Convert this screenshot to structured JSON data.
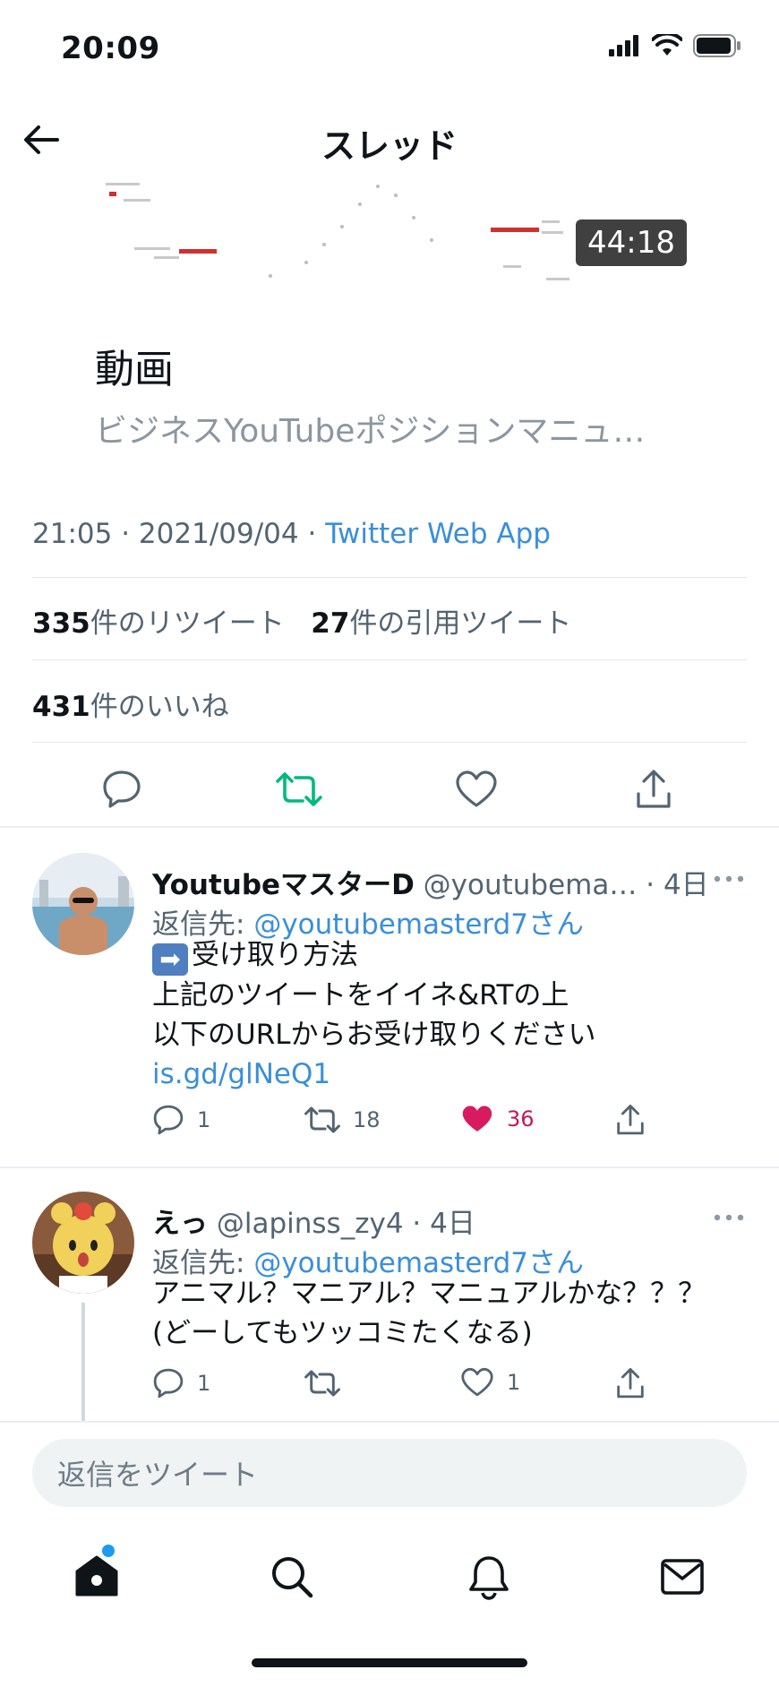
{
  "status_bar": {
    "time": "20:09"
  },
  "header": {
    "title": "スレッド"
  },
  "video": {
    "duration": "44:18"
  },
  "card": {
    "title": "動画",
    "description": "ビジネスYouTubeポジションマニュ…"
  },
  "tweet": {
    "time": "21:05",
    "date": "2021/09/04",
    "source": "Twitter Web App",
    "retweets_count": "335",
    "retweets_label": "件のリツイート",
    "quotes_count": "27",
    "quotes_label": "件の引用ツイート",
    "likes_count": "431",
    "likes_label": "件のいいね"
  },
  "replies": [
    {
      "name": "YoutubeマスターD",
      "handle": "@youtubema…",
      "time": "· 4日",
      "reply_to_prefix": "返信先: ",
      "reply_to": "@youtubemasterd7さん",
      "lines": [
        "受け取り方法",
        "上記のツイートをイイネ&RTの上",
        "以下のURLからお受け取りください"
      ],
      "link": "is.gd/glNeQ1",
      "reply_count": "1",
      "retweet_count": "18",
      "like_count": "36"
    },
    {
      "name": "えっ",
      "handle": "@lapinss_zy4",
      "time": "· 4日",
      "reply_to_prefix": "返信先: ",
      "reply_to": "@youtubemasterd7さん",
      "lines": [
        "アニマル？マニアル？マニュアルかな？？？",
        "(どーしてもツッコミたくなる)"
      ],
      "reply_count": "1",
      "retweet_count": "",
      "like_count": "1"
    }
  ],
  "composer": {
    "placeholder": "返信をツイート"
  },
  "colors": {
    "accent": "#1d9bf0",
    "retweet_green": "#00ba7c",
    "like_pink": "#f91880"
  }
}
